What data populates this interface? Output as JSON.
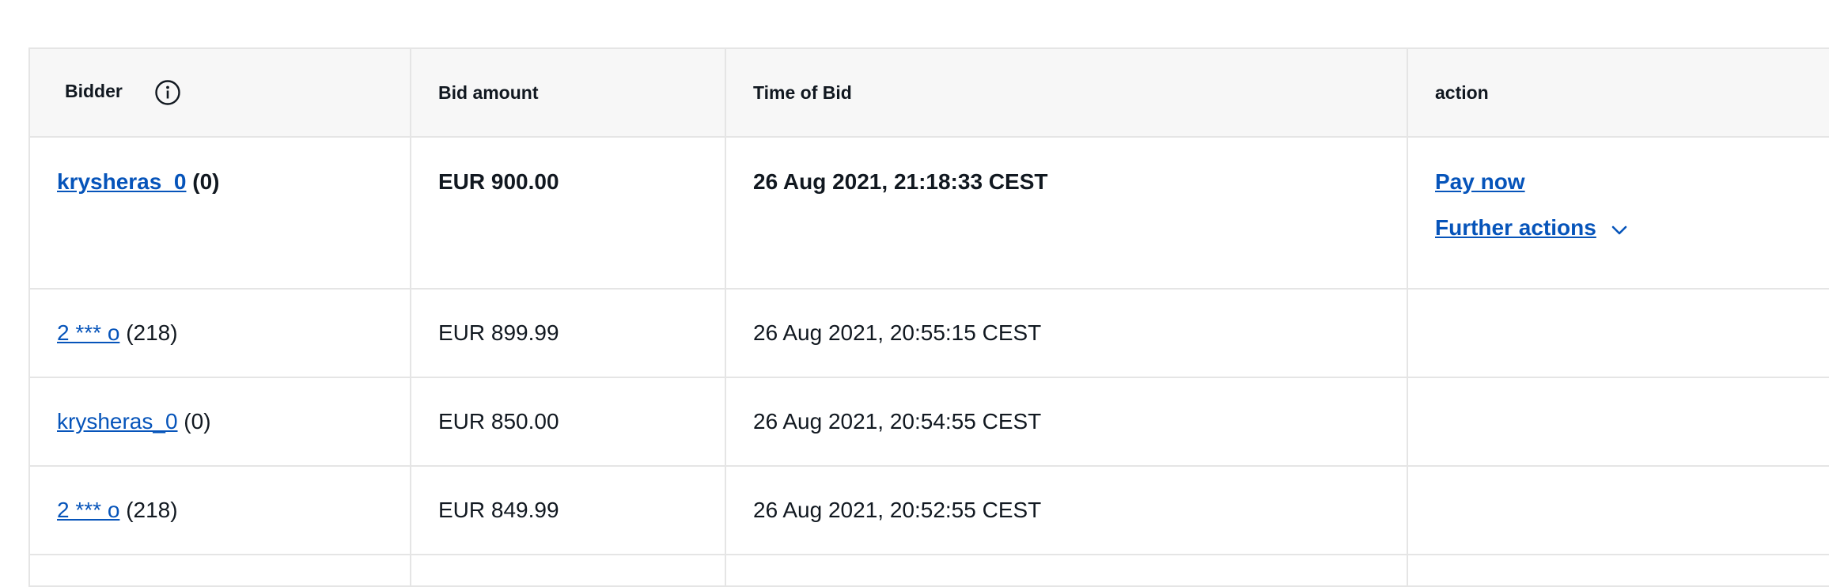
{
  "table": {
    "headers": {
      "bidder": "Bidder",
      "bid_amount": "Bid amount",
      "time_of_bid": "Time of Bid",
      "action": "action"
    },
    "rows": [
      {
        "bidder": "krysheras_0",
        "feedback": "(0)",
        "amount": "EUR 900.00",
        "time": "26 Aug 2021, 21:18:33 CEST",
        "actions": {
          "pay_now": "Pay now",
          "further_actions": "Further actions"
        }
      },
      {
        "bidder": "2 *** o",
        "feedback": "(218)",
        "amount": "EUR 899.99",
        "time": "26 Aug 2021, 20:55:15 CEST"
      },
      {
        "bidder": "krysheras_0",
        "feedback": "(0)",
        "amount": "EUR 850.00",
        "time": "26 Aug 2021, 20:54:55 CEST"
      },
      {
        "bidder": "2 *** o",
        "feedback": "(218)",
        "amount": "EUR 849.99",
        "time": "26 Aug 2021, 20:52:55 CEST"
      }
    ]
  },
  "colors": {
    "link": "#0654ba",
    "header_bg": "#f7f7f7",
    "border": "#e5e5e5",
    "text": "#111820"
  },
  "icons": {
    "info": "info-icon",
    "chevron": "chevron-down-icon"
  }
}
